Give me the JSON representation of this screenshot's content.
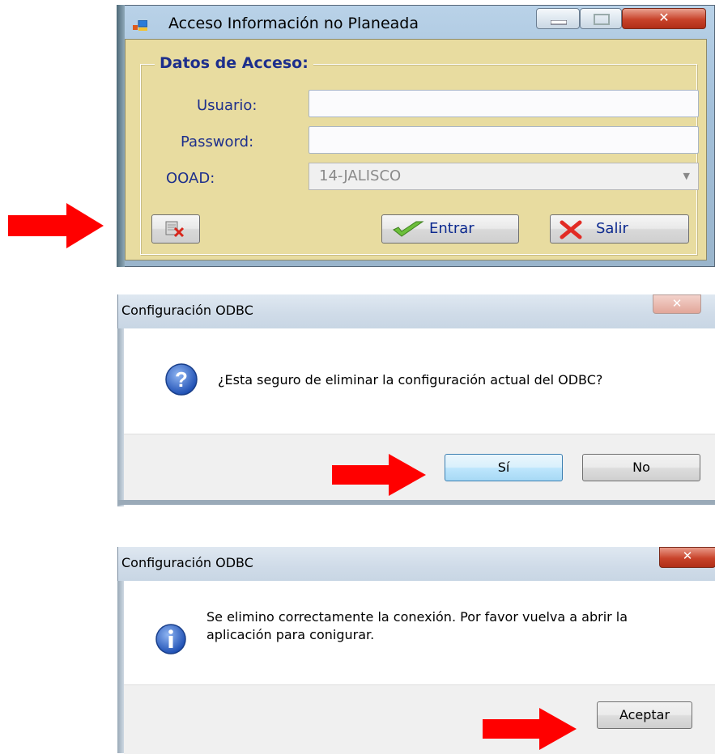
{
  "login_window": {
    "title": "Acceso Información no Planeada",
    "group_title": "Datos de Acceso:",
    "usuario_label": "Usuario:",
    "usuario_value": "",
    "password_label": "Password:",
    "password_value": "",
    "ooad_label": "OOAD:",
    "ooad_value": "14-JALISCO",
    "entrar_label": "Entrar",
    "salir_label": "Salir"
  },
  "confirm_dialog": {
    "title": "Configuración ODBC",
    "message": "¿Esta seguro de eliminar la configuración actual del ODBC?",
    "yes_label": "Sí",
    "no_label": "No"
  },
  "info_dialog": {
    "title": "Configuración ODBC",
    "message_line1": "Se elimino correctamente la conexión. Por favor vuelva a abrir la",
    "message_line2": "aplicación para conigurar.",
    "ok_label": "Aceptar"
  },
  "colors": {
    "arrow": "#ff0000",
    "panel_bg": "#e8dca0",
    "label_text": "#1d2f8c",
    "close_button": "#c8432a"
  },
  "icons": [
    "app-icon",
    "minimize-icon",
    "maximize-icon",
    "close-icon",
    "delete-config-icon",
    "check-icon",
    "x-icon",
    "question-icon",
    "info-icon",
    "arrow-icon"
  ]
}
